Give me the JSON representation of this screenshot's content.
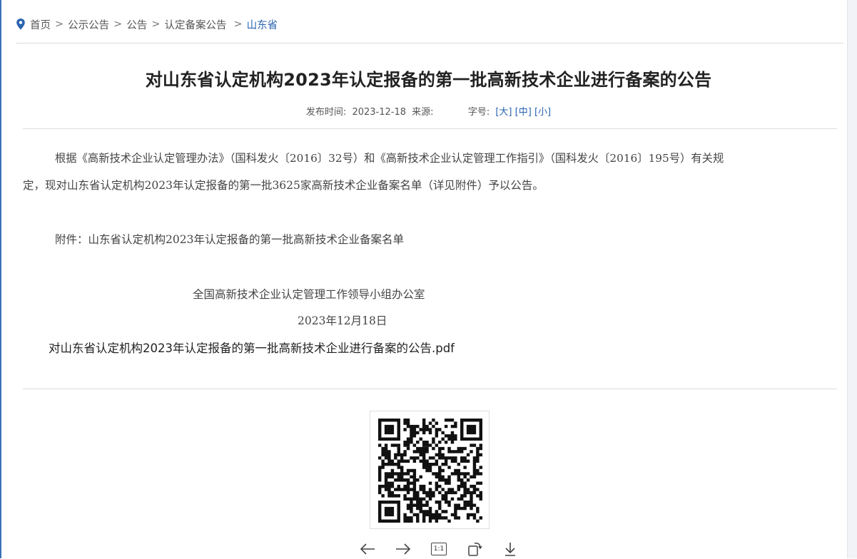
{
  "breadcrumb": {
    "items": [
      "首页",
      "公示公告",
      "公告",
      "认定备案公告"
    ],
    "current": "山东省",
    "separator": ">"
  },
  "article": {
    "title": "对山东省认定机构2023年认定报备的第一批高新技术企业进行备案的公告",
    "meta": {
      "publish_label": "发布时间:",
      "publish_date": "2023-12-18",
      "source_label": "来源:",
      "font_size_label": "字号:",
      "size_large": "[大]",
      "size_medium": "[中]",
      "size_small": "[小]"
    },
    "paragraph_line1": "根据《高新技术企业认定管理办法》（国科发火〔2016〕32号）和《高新技术企业认定管理工作指引》（国科发火〔2016〕195号）有关规",
    "paragraph_line2": "定，现对山东省认定机构2023年认定报备的第一批3625家高新技术企业备案名单（详见附件）予以公告。",
    "attachment_line": "附件：山东省认定机构2023年认定报备的第一批高新技术企业备案名单",
    "signature": "全国高新技术企业认定管理工作领导小组办公室",
    "sign_date": "2023年12月18日",
    "pdf_link": "对山东省认定机构2023年认定报备的第一批高新技术企业进行备案的公告.pdf"
  },
  "image_viewer": {
    "tools": [
      "arrow-left-icon",
      "arrow-right-icon",
      "actual-size-icon",
      "rotate-icon",
      "download-icon"
    ],
    "actual_size_label": "1:1"
  },
  "colors": {
    "accent": "#2a64b0",
    "text": "#333333",
    "divider": "#dcdcdc"
  }
}
